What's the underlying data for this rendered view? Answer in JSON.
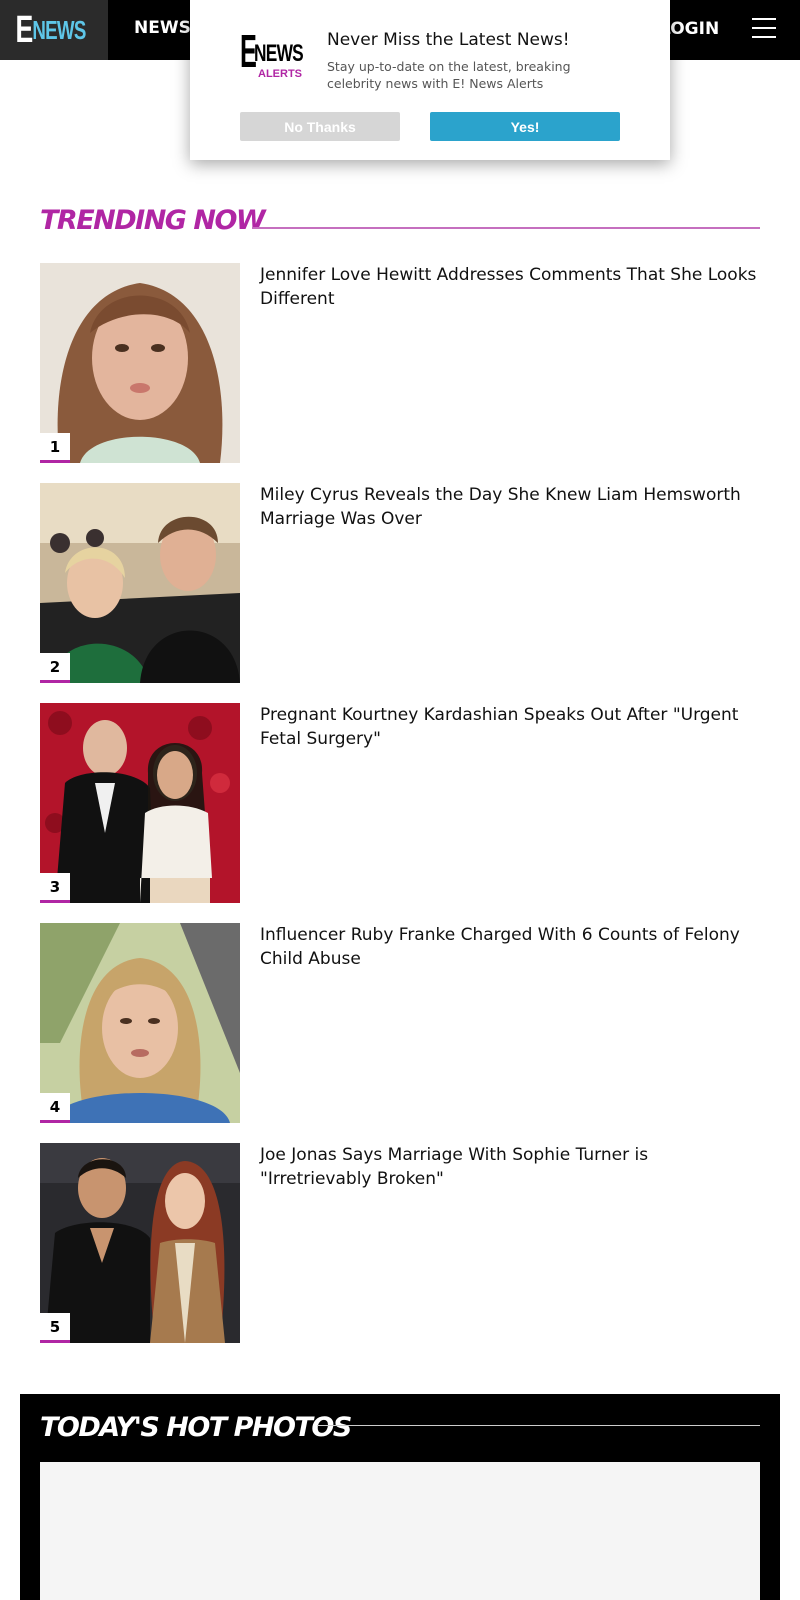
{
  "header": {
    "logo_e": "E",
    "logo_news": "NEWS",
    "nav_news": "NEWS",
    "nav_login": "LOGIN"
  },
  "popup": {
    "logo_e": "E",
    "logo_news": "NEWS",
    "logo_alerts": "ALERTS",
    "title": "Never Miss the Latest News!",
    "subtitle": "Stay up-to-date on the latest, breaking celebrity news with E! News Alerts",
    "no_label": "No Thanks",
    "yes_label": "Yes!"
  },
  "trending": {
    "title": "TRENDING NOW",
    "items": [
      {
        "rank": "1",
        "headline": "Jennifer Love Hewitt Addresses Comments That She Looks Different"
      },
      {
        "rank": "2",
        "headline": "Miley Cyrus Reveals the Day She Knew Liam Hemsworth Marriage Was Over"
      },
      {
        "rank": "3",
        "headline": "Pregnant Kourtney Kardashian Speaks Out After \"Urgent Fetal Surgery\""
      },
      {
        "rank": "4",
        "headline": "Influencer Ruby Franke Charged With 6 Counts of Felony Child Abuse"
      },
      {
        "rank": "5",
        "headline": "Joe Jonas Says Marriage With Sophie Turner is \"Irretrievably Broken\""
      }
    ]
  },
  "hot_photos": {
    "title": "TODAY'S HOT PHOTOS"
  },
  "colors": {
    "accent": "#b026a4",
    "cta": "#2ba3cc",
    "logo_blue": "#5ec6e8"
  }
}
